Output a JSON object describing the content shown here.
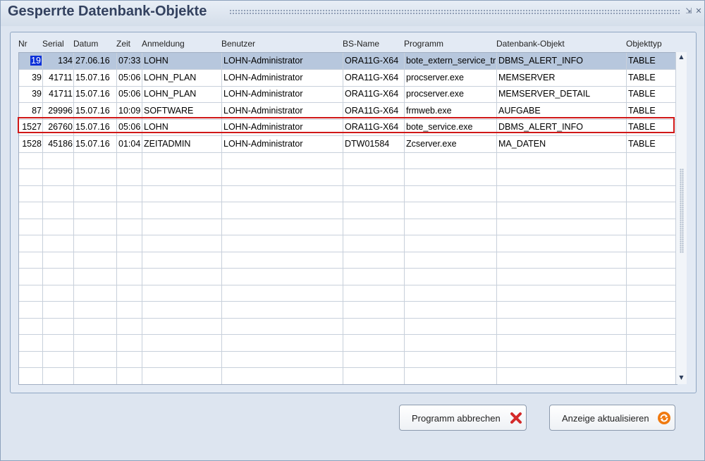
{
  "window": {
    "title": "Gesperrte Datenbank-Objekte",
    "min_glyph": "⇲",
    "close_glyph": "✕"
  },
  "table": {
    "columns": [
      "Nr",
      "Serial",
      "Datum",
      "Zeit",
      "Anmeldung",
      "Benutzer",
      "BS-Name",
      "Programm",
      "Datenbank-Objekt",
      "Objekttyp"
    ],
    "rows": [
      {
        "nr": "19",
        "serial": "134",
        "datum": "27.06.16",
        "zeit": "07:33",
        "anmeldung": "LOHN",
        "benutzer": "LOHN-Administrator",
        "bsname": "ORA11G-X64",
        "programm": "bote_extern_service_tr",
        "objekt": "DBMS_ALERT_INFO",
        "typ": "TABLE"
      },
      {
        "nr": "39",
        "serial": "41711",
        "datum": "15.07.16",
        "zeit": "05:06",
        "anmeldung": "LOHN_PLAN",
        "benutzer": "LOHN-Administrator",
        "bsname": "ORA11G-X64",
        "programm": "procserver.exe",
        "objekt": "MEMSERVER",
        "typ": "TABLE"
      },
      {
        "nr": "39",
        "serial": "41711",
        "datum": "15.07.16",
        "zeit": "05:06",
        "anmeldung": "LOHN_PLAN",
        "benutzer": "LOHN-Administrator",
        "bsname": "ORA11G-X64",
        "programm": "procserver.exe",
        "objekt": "MEMSERVER_DETAIL",
        "typ": "TABLE"
      },
      {
        "nr": "87",
        "serial": "29996",
        "datum": "15.07.16",
        "zeit": "10:09",
        "anmeldung": "SOFTWARE",
        "benutzer": "LOHN-Administrator",
        "bsname": "ORA11G-X64",
        "programm": "frmweb.exe",
        "objekt": "AUFGABE",
        "typ": "TABLE"
      },
      {
        "nr": "1527",
        "serial": "26760",
        "datum": "15.07.16",
        "zeit": "05:06",
        "anmeldung": "LOHN",
        "benutzer": "LOHN-Administrator",
        "bsname": "ORA11G-X64",
        "programm": "bote_service.exe",
        "objekt": "DBMS_ALERT_INFO",
        "typ": "TABLE"
      },
      {
        "nr": "1528",
        "serial": "45186",
        "datum": "15.07.16",
        "zeit": "01:04",
        "anmeldung": "ZEITADMIN",
        "benutzer": "LOHN-Administrator",
        "bsname": "DTW01584",
        "programm": "Zcserver.exe",
        "objekt": "MA_DATEN",
        "typ": "TABLE"
      }
    ],
    "selected_row": 0,
    "highlighted_row": 4,
    "empty_rows": 14
  },
  "scrollbar": {
    "up_glyph": "▲",
    "down_glyph": "▼"
  },
  "buttons": {
    "cancel": {
      "label": "Programm abbrechen",
      "icon": "red-x-icon",
      "color": "#d42a2a"
    },
    "refresh": {
      "label": "Anzeige aktualisieren",
      "icon": "refresh-icon",
      "color": "#f07a10"
    }
  },
  "colors": {
    "title": "#33415f",
    "selection": "#b7c7dd",
    "cell_selection": "#0a2fd8",
    "highlight_border": "#d01818"
  }
}
